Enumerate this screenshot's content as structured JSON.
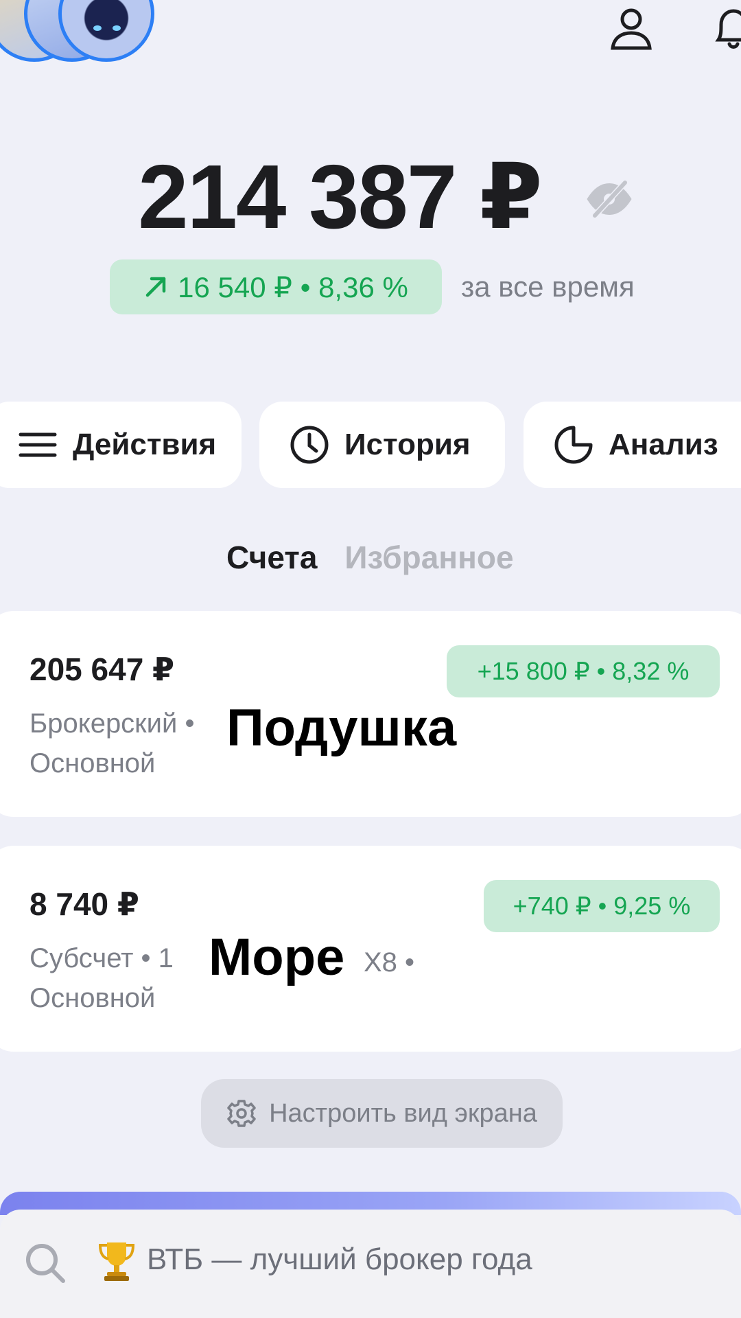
{
  "header": {
    "profile_icon": "profile-icon",
    "notifications_icon": "bell-icon"
  },
  "balance": {
    "total": "214 387 ₽",
    "hide_icon": "eye-off-icon",
    "change_text": "16 540 ₽ • 8,36 %",
    "change_icon": "arrow-up-right-icon",
    "period": "за все время"
  },
  "actions": [
    {
      "label": "Действия",
      "icon": "menu-icon"
    },
    {
      "label": "История",
      "icon": "clock-icon"
    },
    {
      "label": "Анализ",
      "icon": "pie-chart-icon"
    }
  ],
  "tabs": [
    {
      "label": "Счета",
      "active": true
    },
    {
      "label": "Избранное",
      "active": false
    }
  ],
  "accounts": [
    {
      "amount": "205 647 ₽",
      "change": "+15 800 ₽ • 8,32 %",
      "type": "Брокерский • Основной",
      "name_overlay": "Подушка",
      "extra": ""
    },
    {
      "amount": "8 740 ₽",
      "change": "+740 ₽ • 9,25 %",
      "type": "Субсчет • 1 Основной",
      "name_overlay": "Море",
      "extra": "X8 •"
    }
  ],
  "customize": {
    "label": "Настроить вид экрана",
    "icon": "gear-icon"
  },
  "search": {
    "icon": "search-icon",
    "promo_icon": "trophy-icon",
    "text": "ВТБ — лучший брокер года"
  },
  "colors": {
    "background": "#eff0f8",
    "positive": "#15a552",
    "positive_bg": "#c9ebd8",
    "muted": "#7c7f88",
    "accent_blue": "#2d7ff5"
  }
}
